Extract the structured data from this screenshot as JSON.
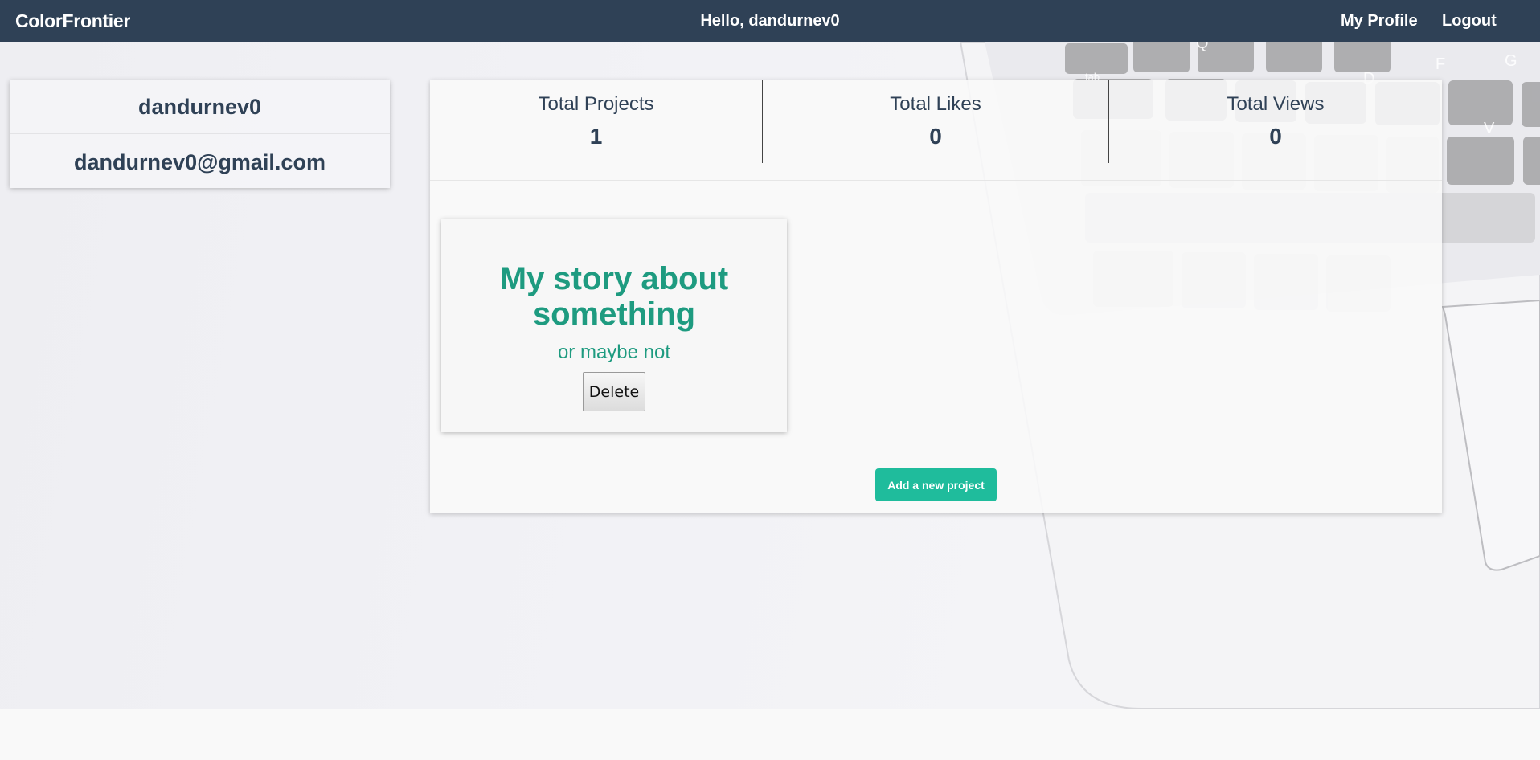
{
  "navbar": {
    "brand": "ColorFrontier",
    "greeting": "Hello, dandurnev0",
    "profile_link": "My Profile",
    "logout_link": "Logout"
  },
  "user": {
    "username": "dandurnev0",
    "email": "dandurnev0@gmail.com"
  },
  "stats": [
    {
      "label": "Total Projects",
      "value": "1"
    },
    {
      "label": "Total Likes",
      "value": "0"
    },
    {
      "label": "Total Views",
      "value": "0"
    }
  ],
  "projects": [
    {
      "title": "My story about something",
      "subtitle": "or maybe not",
      "delete_label": "Delete"
    }
  ],
  "actions": {
    "add_project_label": "Add a new project"
  },
  "colors": {
    "navbar": "#2f4156",
    "text_primary": "#2f4156",
    "accent": "#1fbc9c",
    "project_text": "#1e9b80"
  },
  "background": {
    "keyboard_keys": [
      "Q",
      "F",
      "G",
      "D",
      "V",
      "tab"
    ]
  }
}
